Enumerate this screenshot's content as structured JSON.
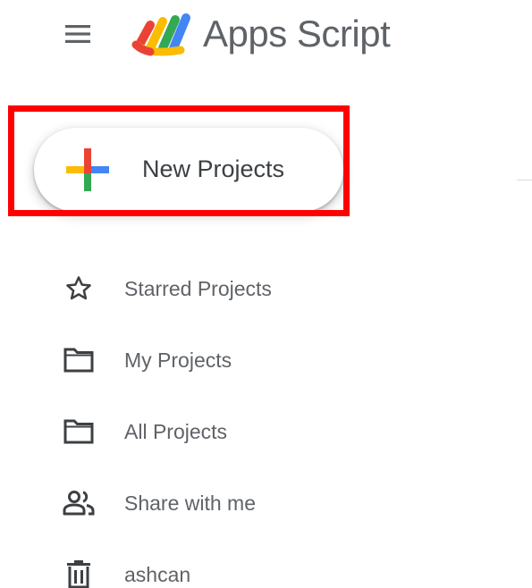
{
  "header": {
    "menu_icon": "hamburger-menu-icon",
    "logo_icon": "apps-script-logo-icon",
    "title": "Apps Script"
  },
  "new_project": {
    "label": "New Projects",
    "icon": "plus-icon",
    "highlight_color": "#ff0000"
  },
  "sidebar": {
    "items": [
      {
        "label": "Starred Projects",
        "icon": "star-icon"
      },
      {
        "label": "My Projects",
        "icon": "folder-icon"
      },
      {
        "label": "All Projects",
        "icon": "folder-icon"
      },
      {
        "label": "Share with me",
        "icon": "people-icon"
      },
      {
        "label": "ashcan",
        "icon": "trash-icon"
      }
    ]
  },
  "colors": {
    "text": "#5f6368",
    "google_blue": "#4285f4",
    "google_red": "#ea4335",
    "google_yellow": "#fbbc04",
    "google_green": "#34a853"
  }
}
